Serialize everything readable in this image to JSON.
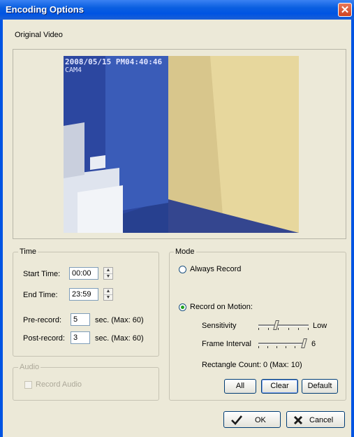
{
  "window": {
    "title": "Encoding Options",
    "close_glyph": "✕"
  },
  "original_video": {
    "label": "Original Video",
    "overlay_timestamp": "2008/05/15 PM04:40:46",
    "overlay_camera": "CAM4"
  },
  "time": {
    "legend": "Time",
    "start_label": "Start Time:",
    "start_value": "00:00",
    "end_label": "End Time:",
    "end_value": "23:59",
    "prerecord_label": "Pre-record:",
    "prerecord_value": "5",
    "prerecord_suffix": "sec. (Max: 60)",
    "postrecord_label": "Post-record:",
    "postrecord_value": "3",
    "postrecord_suffix": "sec. (Max: 60)"
  },
  "audio": {
    "legend": "Audio",
    "record_label": "Record Audio",
    "checked": false,
    "enabled": false
  },
  "mode": {
    "legend": "Mode",
    "always_label": "Always Record",
    "always_selected": false,
    "motion_label": "Record on Motion:",
    "motion_selected": true,
    "sensitivity_label": "Sensitivity",
    "sensitivity_value_label": "Low",
    "sensitivity_level": 0.35,
    "frame_label": "Frame Interval",
    "frame_value_label": "6",
    "frame_level": 1.0,
    "rect_count": "Rectangle Count: 0  (Max: 10)",
    "all_label": "All",
    "clear_label": "Clear",
    "default_label": "Default"
  },
  "footer": {
    "ok_label": "OK",
    "cancel_label": "Cancel"
  },
  "colors": {
    "title_bar": "#0054E3",
    "dialog_bg": "#ECE9D8",
    "check_icon": "#1a1a1a",
    "cancel_icon": "#1a1a1a"
  }
}
